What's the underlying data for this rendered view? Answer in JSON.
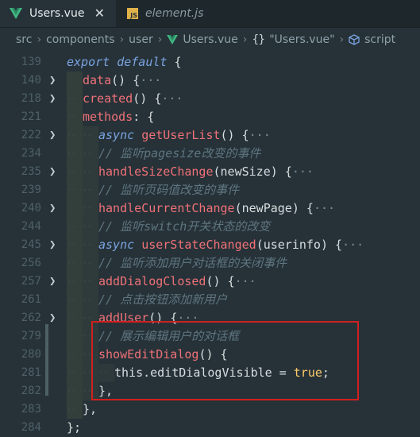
{
  "tabs": [
    {
      "label": "Users.vue",
      "icon": "vue-icon",
      "active": true
    },
    {
      "label": "element.js",
      "icon": "js-icon",
      "active": false
    }
  ],
  "js_icon_text": "JS",
  "breadcrumb": [
    "src",
    "components",
    "user",
    "Users.vue",
    "\"Users.vue\"",
    "script"
  ],
  "braces_text": "{}",
  "lines": [
    {
      "num": "139",
      "fold": false,
      "indent": 0,
      "tokens": [
        {
          "c": "kw",
          "t": "export default "
        },
        {
          "c": "tx",
          "t": "{"
        }
      ]
    },
    {
      "num": "140",
      "fold": true,
      "indent": 1,
      "tokens": [
        {
          "c": "fn",
          "t": "data"
        },
        {
          "c": "tx",
          "t": "() "
        },
        {
          "c": "tx",
          "t": "{"
        },
        {
          "c": "el",
          "t": "···"
        }
      ]
    },
    {
      "num": "218",
      "fold": true,
      "indent": 1,
      "tokens": [
        {
          "c": "fn",
          "t": "created"
        },
        {
          "c": "tx",
          "t": "() "
        },
        {
          "c": "tx",
          "t": "{"
        },
        {
          "c": "el",
          "t": "···"
        }
      ]
    },
    {
      "num": "221",
      "fold": false,
      "indent": 1,
      "tokens": [
        {
          "c": "fn",
          "t": "methods"
        },
        {
          "c": "tx",
          "t": ": {"
        }
      ]
    },
    {
      "num": "222",
      "fold": true,
      "indent": 2,
      "tokens": [
        {
          "c": "kw",
          "t": "async "
        },
        {
          "c": "fn",
          "t": "getUserList"
        },
        {
          "c": "tx",
          "t": "() "
        },
        {
          "c": "tx",
          "t": "{"
        },
        {
          "c": "el",
          "t": "···"
        }
      ]
    },
    {
      "num": "234",
      "fold": false,
      "indent": 2,
      "tokens": [
        {
          "c": "cm",
          "t": "// 监听pagesize改变的事件"
        }
      ]
    },
    {
      "num": "235",
      "fold": true,
      "indent": 2,
      "tokens": [
        {
          "c": "fn",
          "t": "handleSizeChange"
        },
        {
          "c": "tx",
          "t": "(newSize) "
        },
        {
          "c": "tx",
          "t": "{"
        },
        {
          "c": "el",
          "t": "···"
        }
      ]
    },
    {
      "num": "239",
      "fold": false,
      "indent": 2,
      "tokens": [
        {
          "c": "cm",
          "t": "// 监听页码值改变的事件"
        }
      ]
    },
    {
      "num": "240",
      "fold": true,
      "indent": 2,
      "tokens": [
        {
          "c": "fn",
          "t": "handleCurrentChange"
        },
        {
          "c": "tx",
          "t": "(newPage) "
        },
        {
          "c": "tx",
          "t": "{"
        },
        {
          "c": "el",
          "t": "···"
        }
      ]
    },
    {
      "num": "244",
      "fold": false,
      "indent": 2,
      "tokens": [
        {
          "c": "cm",
          "t": "// 监听switch开关状态的改变"
        }
      ]
    },
    {
      "num": "245",
      "fold": true,
      "indent": 2,
      "tokens": [
        {
          "c": "kw",
          "t": "async "
        },
        {
          "c": "fn",
          "t": "userStateChanged"
        },
        {
          "c": "tx",
          "t": "(userinfo) "
        },
        {
          "c": "tx",
          "t": "{"
        },
        {
          "c": "el",
          "t": "···"
        }
      ]
    },
    {
      "num": "256",
      "fold": false,
      "indent": 2,
      "tokens": [
        {
          "c": "cm",
          "t": "// 监听添加用户对话框的关闭事件"
        }
      ]
    },
    {
      "num": "257",
      "fold": true,
      "indent": 2,
      "tokens": [
        {
          "c": "fn",
          "t": "addDialogClosed"
        },
        {
          "c": "tx",
          "t": "() "
        },
        {
          "c": "tx",
          "t": "{"
        },
        {
          "c": "el",
          "t": "···"
        }
      ]
    },
    {
      "num": "261",
      "fold": false,
      "indent": 2,
      "tokens": [
        {
          "c": "cm",
          "t": "// 点击按钮添加新用户"
        }
      ]
    },
    {
      "num": "262",
      "fold": true,
      "indent": 2,
      "tokens": [
        {
          "c": "fn",
          "t": "addUser"
        },
        {
          "c": "tx",
          "t": "() "
        },
        {
          "c": "tx",
          "t": "{"
        },
        {
          "c": "el",
          "t": "···"
        }
      ]
    },
    {
      "num": "279",
      "fold": false,
      "indent": 2,
      "tokens": [
        {
          "c": "cm",
          "t": "// 展示编辑用户的对话框"
        }
      ]
    },
    {
      "num": "280",
      "fold": false,
      "indent": 2,
      "tokens": [
        {
          "c": "fn",
          "t": "showEditDialog"
        },
        {
          "c": "tx",
          "t": "() {"
        }
      ]
    },
    {
      "num": "281",
      "fold": false,
      "indent": 3,
      "tokens": [
        {
          "c": "this",
          "t": "this"
        },
        {
          "c": "tx",
          "t": ".editDialogVisible = "
        },
        {
          "c": "bool",
          "t": "true"
        },
        {
          "c": "tx",
          "t": ";"
        }
      ]
    },
    {
      "num": "282",
      "fold": false,
      "indent": 2,
      "tokens": [
        {
          "c": "tx",
          "t": "},"
        }
      ]
    },
    {
      "num": "283",
      "fold": false,
      "indent": 1,
      "tokens": [
        {
          "c": "tx",
          "t": "},"
        }
      ]
    },
    {
      "num": "284",
      "fold": false,
      "indent": 0,
      "tokens": [
        {
          "c": "tx",
          "t": "};"
        }
      ]
    }
  ]
}
